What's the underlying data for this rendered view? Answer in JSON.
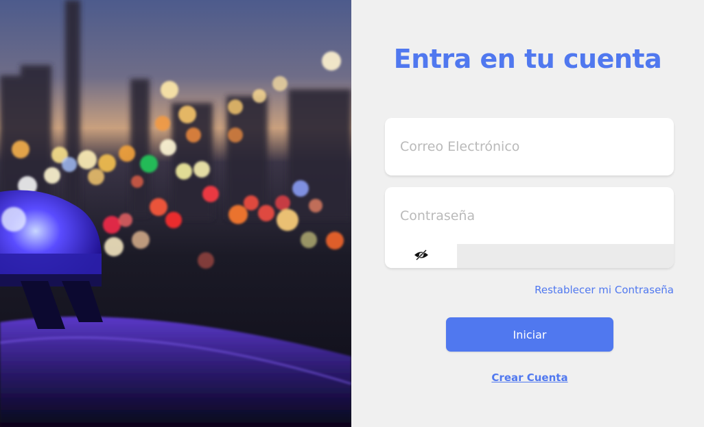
{
  "hero": {
    "image": "city-night-police-light-bokeh"
  },
  "form": {
    "title": "Entra en tu cuenta",
    "email_placeholder": "Correo Electrónico",
    "email_value": "",
    "password_placeholder": "Contraseña",
    "password_value": "",
    "toggle_icon": "eye-slash-icon",
    "forgot_label": "Restablecer mi Contraseña",
    "submit_label": "Iniciar",
    "create_label": "Crear Cuenta"
  },
  "colors": {
    "accent": "#5078ef",
    "panel_bg": "#f0f0f0",
    "field_bg": "#ffffff",
    "placeholder": "#b9b9b9"
  }
}
